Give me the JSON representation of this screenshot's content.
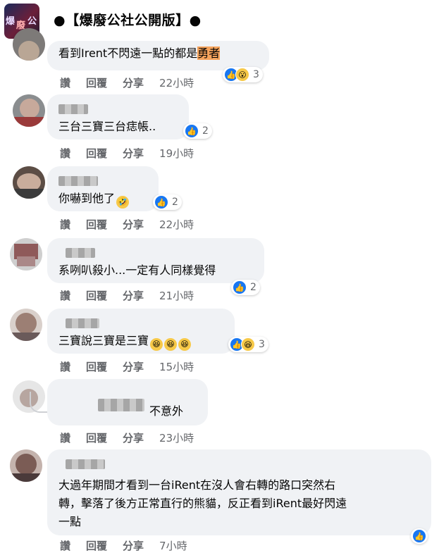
{
  "group": {
    "title": "●【爆廢公社公開版】●"
  },
  "actions": {
    "read": "讚",
    "reply": "回覆",
    "share": "分享"
  },
  "comments": [
    {
      "text_before": "看到Irent不閃遠一點的都是",
      "text_highlight": "勇者",
      "time": "22小時",
      "reaction_count": "3"
    },
    {
      "text": "三台三寶三台痣帳..",
      "time": "19小時",
      "reaction_count": "2"
    },
    {
      "text": "你嚇到他了",
      "time": "22小時",
      "reaction_count": "2"
    },
    {
      "text": "系咧叭殺小...一定有人同樣覺得",
      "time": "21小時",
      "reaction_count": "2"
    },
    {
      "text": "三寶說三寶是三寶",
      "time": "15小時",
      "reaction_count": "3"
    },
    {
      "text": "不意外",
      "time": "23小時"
    },
    {
      "lines": [
        "大過年期間才看到一台iRent在沒人會右轉的路口突然右",
        "轉，擊落了後方正常直行的熊貓，反正看到iRent最好閃遠",
        "一點"
      ],
      "time": "7小時"
    }
  ],
  "icons": {
    "like": "like-thumb-icon",
    "wow": "wow-emoji-icon",
    "laugh": "laugh-emoji-icon",
    "rofl": "rofl-emoji-icon"
  },
  "colors": {
    "like_blue": "#1877f2",
    "bubble": "#f0f2f5",
    "highlight": "#f5a35c"
  }
}
